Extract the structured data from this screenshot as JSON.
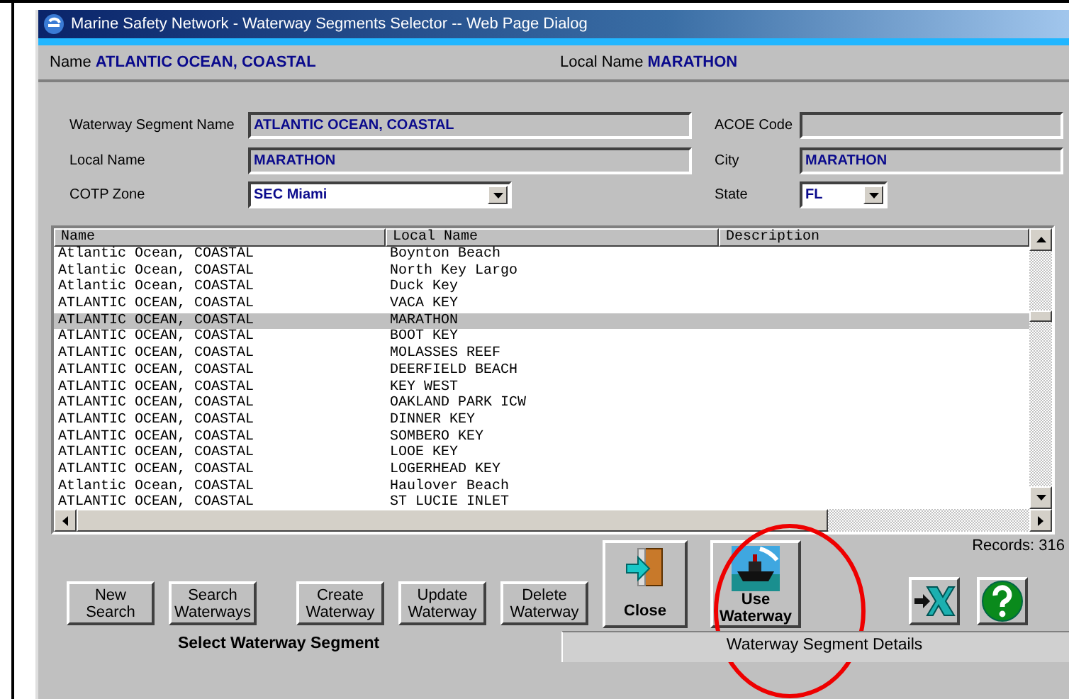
{
  "window": {
    "title": "Marine Safety Network - Waterway Segments Selector -- Web Page Dialog"
  },
  "header": {
    "name_label": "Name",
    "name_value": "ATLANTIC OCEAN, COASTAL",
    "local_label": "Local Name",
    "local_value": "MARATHON"
  },
  "form": {
    "left": [
      {
        "kind": "text",
        "label": "Waterway Segment Name",
        "value": "ATLANTIC OCEAN, COASTAL"
      },
      {
        "kind": "text",
        "label": "Local Name",
        "value": "MARATHON"
      },
      {
        "kind": "select",
        "label": "COTP Zone",
        "value": "SEC Miami"
      }
    ],
    "right": [
      {
        "kind": "text",
        "label": "ACOE Code"
      },
      {
        "kind": "text",
        "label": "City",
        "value": "MARATHON"
      },
      {
        "kind": "select",
        "label": "State",
        "value": "FL"
      }
    ]
  },
  "table": {
    "columns": [
      "Name",
      "Local Name",
      "Description"
    ],
    "rows": [
      {
        "name": "Atlantic Ocean, COASTAL",
        "local": "Boynton Beach",
        "selected": false
      },
      {
        "name": "Atlantic Ocean, COASTAL",
        "local": "North Key Largo",
        "selected": false
      },
      {
        "name": "Atlantic Ocean, COASTAL",
        "local": "Duck Key",
        "selected": false
      },
      {
        "name": "ATLANTIC OCEAN, COASTAL",
        "local": "VACA KEY",
        "selected": false
      },
      {
        "name": "ATLANTIC OCEAN, COASTAL",
        "local": "MARATHON",
        "selected": true
      },
      {
        "name": "ATLANTIC OCEAN, COASTAL",
        "local": "BOOT KEY",
        "selected": false
      },
      {
        "name": "ATLANTIC OCEAN, COASTAL",
        "local": "MOLASSES REEF",
        "selected": false
      },
      {
        "name": "ATLANTIC OCEAN, COASTAL",
        "local": "DEERFIELD BEACH",
        "selected": false
      },
      {
        "name": "ATLANTIC OCEAN, COASTAL",
        "local": "KEY WEST",
        "selected": false
      },
      {
        "name": "ATLANTIC OCEAN, COASTAL",
        "local": "OAKLAND PARK ICW",
        "selected": false
      },
      {
        "name": "ATLANTIC OCEAN, COASTAL",
        "local": "DINNER KEY",
        "selected": false
      },
      {
        "name": "ATLANTIC OCEAN, COASTAL",
        "local": "SOMBERO KEY",
        "selected": false
      },
      {
        "name": "ATLANTIC OCEAN, COASTAL",
        "local": "LOOE KEY",
        "selected": false
      },
      {
        "name": "ATLANTIC OCEAN, COASTAL",
        "local": "LOGERHEAD KEY",
        "selected": false
      },
      {
        "name": "Atlantic Ocean, COASTAL",
        "local": "Haulover Beach",
        "selected": false
      },
      {
        "name": "ATLANTIC OCEAN, COASTAL",
        "local": "ST LUCIE INLET",
        "selected": false
      }
    ],
    "records": "Records: 316"
  },
  "buttons": [
    {
      "kind": "text",
      "lines": [
        "New",
        "Search"
      ]
    },
    {
      "kind": "text",
      "lines": [
        "Search",
        "Waterways"
      ]
    },
    {
      "kind": "text",
      "lines": [
        "Create",
        "Waterway"
      ]
    },
    {
      "kind": "text",
      "lines": [
        "Update",
        "Waterway"
      ]
    },
    {
      "kind": "text",
      "lines": [
        "Delete",
        "Waterway"
      ]
    },
    {
      "kind": "close",
      "lines": [
        "Close"
      ]
    },
    {
      "kind": "use",
      "lines": [
        "Use",
        "Waterway"
      ]
    },
    {
      "kind": "excel"
    },
    {
      "kind": "help"
    }
  ],
  "tabs": [
    {
      "label": "Select Waterway Segment",
      "selected": true
    },
    {
      "label": "Waterway Segment Details",
      "selected": false
    }
  ]
}
